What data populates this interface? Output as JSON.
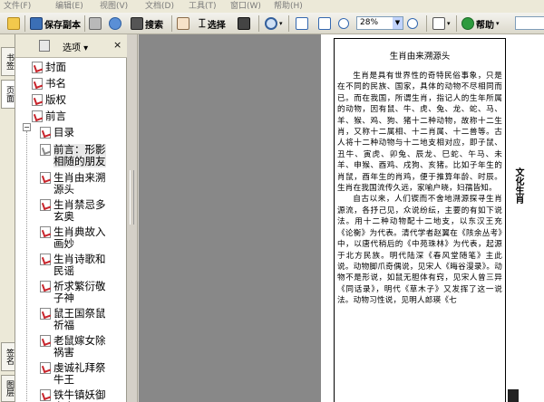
{
  "menu": [
    "文件(F)",
    "编辑(E)",
    "视图(V)",
    "文档(D)",
    "工具(T)",
    "窗口(W)",
    "帮助(H)"
  ],
  "toolbar": {
    "save_copy": "保存副本",
    "search": "搜索",
    "select": "选择",
    "zoom": "28%",
    "help": "帮助"
  },
  "tabs": [
    "书签",
    "页面",
    "签名",
    "图层"
  ],
  "panel": {
    "options": "选项 ▾",
    "close": "×"
  },
  "bookmarks": [
    {
      "label": "封面"
    },
    {
      "label": "书名"
    },
    {
      "label": "版权"
    },
    {
      "label": "前言"
    },
    {
      "label": "目录"
    },
    {
      "label": "前言：形影\n相随的朋友"
    },
    {
      "label": "生肖由来溯\n源头"
    },
    {
      "label": "生肖禁忌多\n玄奥"
    },
    {
      "label": "生肖典故入\n画妙"
    },
    {
      "label": "生肖诗歌和\n民谣"
    },
    {
      "label": "祈求繁衍敬\n子神"
    },
    {
      "label": "鼠王国祭鼠\n祈福"
    },
    {
      "label": "老鼠嫁女除\n祸害"
    },
    {
      "label": "虔诚礼拜祭\n牛王"
    },
    {
      "label": "铁牛镇妖御\n水患"
    }
  ],
  "document": {
    "title": "生肖由来溯源头",
    "paragraphs": [
      "生肖是具有世界性的奇特民俗事象，只是在不同的民族、国家，具体的动物不尽相同而已。而在我国，所谓生肖，指记人的生年所属的动物，因有鼠、牛、虎、兔、龙、蛇、马、羊、猴、鸡、狗、猪十二种动物，故称十二生肖，又称十二属相、十二肖属、十二兽等。古人将十二种动物与十二地支相对应，即子鼠、丑牛、寅虎、卯兔、辰龙、巳蛇、午马、未羊、申猴、酉鸡、戌狗、亥猪。比如子年生的肖鼠，酉年生的肖鸡，便于推算年龄、时辰。生肖在我国流传久远，家喻户晓，妇孺皆知。",
      "自古以来，人们锲而不舍地溯源探寻生肖源流，各抒己见，众说纷纭，主要的有如下说法。用十二种动物配十二地支，以东汉王充《论衡》为代表。清代学者赵翼在《陔余丛考》中，以唐代稍后的《中苑珠林》为代表，起源于北方民族。明代陆深《春风堂随笔》主此说。动物脚爪奇偶说，见宋人《晦谷漫录》。动物不是形说，如鼠无胆体有窍，见宋人曾三异《同话录》，明代《草木子》又发挥了这一说法。动物习性说，见明人郎瑛《七"
    ],
    "side_title": "文化生肖"
  }
}
